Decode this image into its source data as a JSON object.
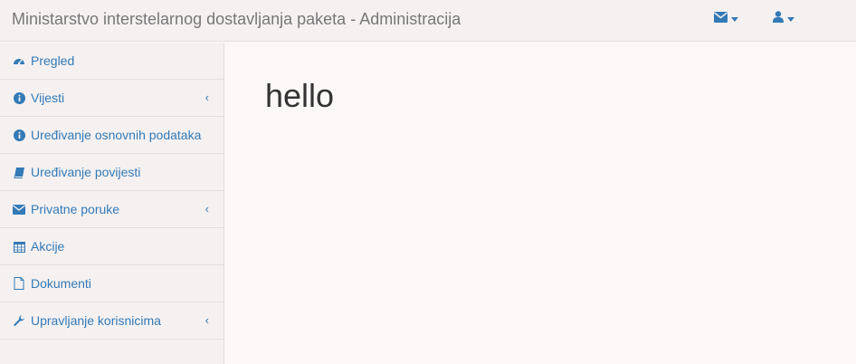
{
  "header": {
    "brand": "Ministarstvo interstelarnog dostavljanja paketa - Administracija",
    "messages_icon": "envelope-icon",
    "user_icon": "user-icon"
  },
  "sidebar": {
    "items": [
      {
        "label": "Pregled",
        "icon": "dashboard-icon",
        "has_submenu": false
      },
      {
        "label": "Vijesti",
        "icon": "info-icon",
        "has_submenu": true
      },
      {
        "label": "Uređivanje osnovnih podataka",
        "icon": "info-icon",
        "has_submenu": false
      },
      {
        "label": "Uređivanje povijesti",
        "icon": "book-icon",
        "has_submenu": false
      },
      {
        "label": "Privatne poruke",
        "icon": "envelope-icon",
        "has_submenu": true
      },
      {
        "label": "Akcije",
        "icon": "calendar-icon",
        "has_submenu": false
      },
      {
        "label": "Dokumenti",
        "icon": "file-icon",
        "has_submenu": false
      },
      {
        "label": "Upravljanje korisnicima",
        "icon": "wrench-icon",
        "has_submenu": true
      }
    ],
    "submenu_arrow": "‹"
  },
  "main": {
    "title": "hello"
  },
  "colors": {
    "link": "#337ab7",
    "brand_text": "#777777",
    "background": "#fcf8f8",
    "sidebar_bg": "#f5f1f1"
  }
}
